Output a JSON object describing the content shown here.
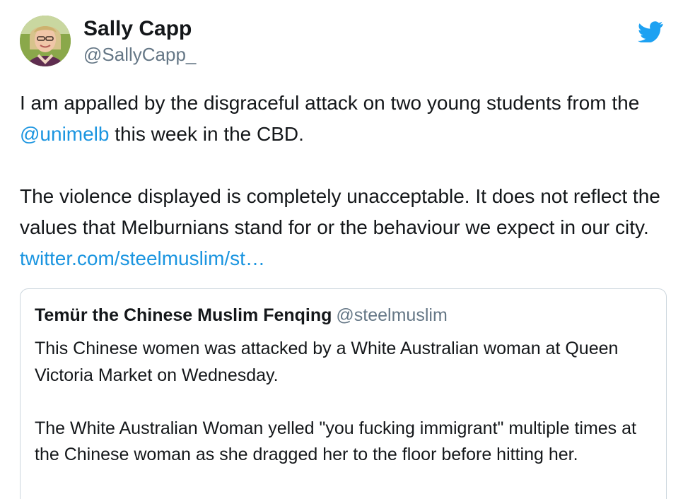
{
  "tweet": {
    "author": {
      "display_name": "Sally Capp",
      "handle": "@SallyCapp_"
    },
    "icon": "twitter-bird-icon",
    "accent_color": "#1b95e0",
    "body": {
      "paragraph_1": {
        "part_1": "I am appalled by the disgraceful attack on two young students from the ",
        "mention": "@unimelb",
        "part_2": " this week in the CBD."
      },
      "paragraph_2": {
        "text": "The violence displayed is completely unacceptable. It does not reflect the values that Melburnians stand for or the behaviour we expect in our city. ",
        "link": "twitter.com/steelmuslim/st…"
      }
    }
  },
  "quoted_tweet": {
    "author": "Temür the Chinese Muslim Fenqing",
    "handle": "@steelmuslim",
    "paragraph_1": "This Chinese women was attacked by a White Australian woman at Queen Victoria Market on Wednesday.",
    "paragraph_2": "The White Australian Woman yelled \"you fucking immigrant\"  multiple times at the Chinese woman as she dragged her to the floor before hitting her."
  }
}
